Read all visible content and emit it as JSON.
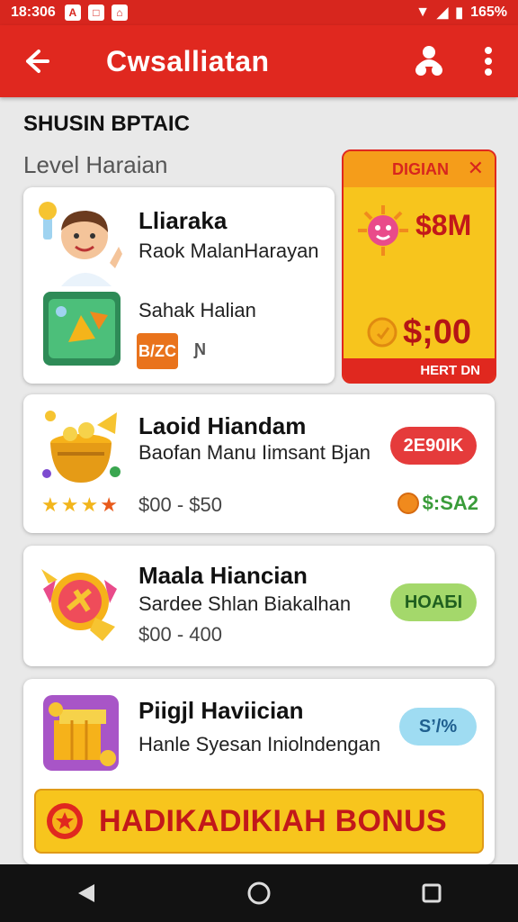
{
  "status_bar": {
    "time": "18:306",
    "battery": "165%"
  },
  "app_bar": {
    "title": "Cwsalliatan"
  },
  "section": {
    "title": "SHUSIN BPTAIC",
    "level_label": "Level Haraian"
  },
  "card1": {
    "title": "Lliaraka",
    "subtitle": "Raok MalanHarayan",
    "item2_label": "Sahak Halian",
    "tag_label": "B/ZC",
    "count": "Ɲ"
  },
  "promo": {
    "tag": "DIGIAN",
    "amount_top": "$8M",
    "amount_bottom": "$;00",
    "footer": "HERT DN"
  },
  "card2": {
    "title": "Laoid Hiandam",
    "subtitle": "Baofan Manu Iimsant Bjan",
    "price_range": "$00 - $50",
    "pill_label": "2E90IK",
    "coin_value": "$:SA2",
    "rating": 4
  },
  "card3": {
    "title": "Maala Hiancian",
    "subtitle": "Sardee Shlan Biakalhan",
    "price_range": "$00 - 400",
    "pill_label": "HOAБI"
  },
  "card4": {
    "title": "Piigjl Haviician",
    "subtitle": "Hanle Syesan Iniolndengan",
    "pill_label": "S’/%",
    "bonus_label": "HADIKADIKIAH BONUS"
  },
  "colors": {
    "primary_red": "#e0281f",
    "promo_yellow": "#f7c51d",
    "pill_red": "#e53b3b",
    "pill_green": "#a4d86b",
    "pill_blue": "#9fdcf2",
    "tag_orange": "#e9731c"
  },
  "icons": {
    "back": "arrow-left-icon",
    "profile": "users-icon",
    "menu": "more-vertical-icon"
  }
}
